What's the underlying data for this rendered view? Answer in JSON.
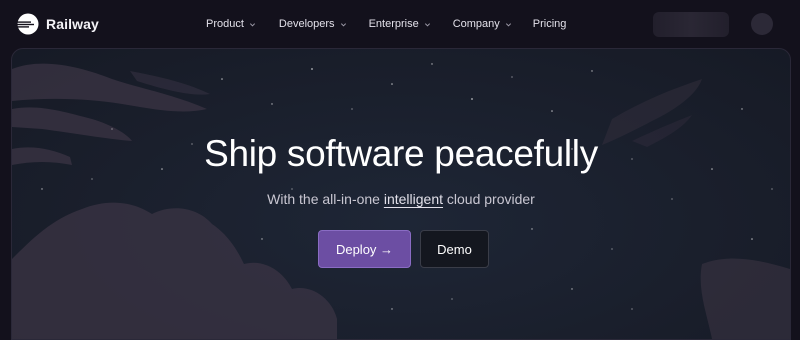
{
  "brand": {
    "name": "Railway",
    "icon": "railway-logo-icon"
  },
  "nav": {
    "items": [
      {
        "label": "Product",
        "dropdown": true
      },
      {
        "label": "Developers",
        "dropdown": true
      },
      {
        "label": "Enterprise",
        "dropdown": true
      },
      {
        "label": "Company",
        "dropdown": true
      },
      {
        "label": "Pricing",
        "dropdown": false
      }
    ]
  },
  "hero": {
    "title": "Ship software peacefully",
    "subtitle_before": "With the all-in-one ",
    "subtitle_link": "intelligent",
    "subtitle_after": " cloud provider",
    "deploy_label": "Deploy →",
    "demo_label": "Demo"
  },
  "colors": {
    "page_bg": "#13111c",
    "accent": "#6c4ea3",
    "hero_bg": "#1a1f2c"
  }
}
